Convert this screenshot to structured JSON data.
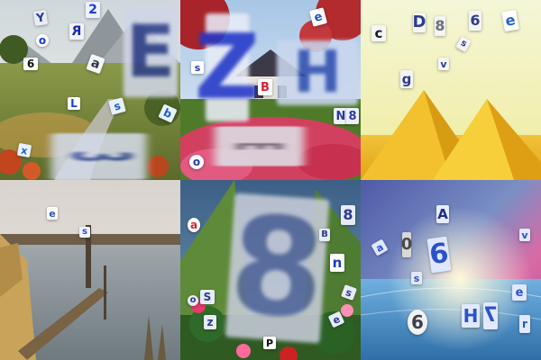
{
  "tiles": [
    {
      "theme": "mountain-valley",
      "glyphs": [
        {
          "char": "E",
          "color": "#2d3f8a",
          "bg": "#cfd6e6"
        },
        {
          "char": "3",
          "color": "#3a4f9c",
          "bg": "#d4dbe9"
        },
        {
          "char": "Y",
          "color": "#1f3b9b",
          "bg": "#e9edf5"
        },
        {
          "char": "2",
          "color": "#1d3ad8",
          "bg": "#eef2ff"
        },
        {
          "char": "R",
          "color": "#1b2ab0",
          "bg": "#f2f4fb"
        },
        {
          "char": "a",
          "color": "#2d2f4a",
          "bg": "#f5f5f5"
        },
        {
          "char": "6",
          "color": "#111111",
          "bg": "#ffffff"
        },
        {
          "char": "o",
          "color": "#1a3fd0",
          "bg": "#ffffff"
        },
        {
          "char": "L",
          "color": "#1a3fd0",
          "bg": "#ffffff"
        },
        {
          "char": "s",
          "color": "#1f5fbf",
          "bg": "#e8f1ff"
        },
        {
          "char": "b",
          "color": "#1f5fbf",
          "bg": "#e8f1ff"
        },
        {
          "char": "x",
          "color": "#1f5fbf",
          "bg": "#e8f1ff"
        }
      ]
    },
    {
      "theme": "cottage-garden",
      "glyphs": [
        {
          "char": "Z",
          "color": "#2438c8",
          "bg": "#e9ecf7"
        },
        {
          "char": "H",
          "color": "#2f4fb0",
          "bg": "#c9d6ee"
        },
        {
          "char": "E",
          "color": "#6f7381",
          "bg": "#dde0e6"
        },
        {
          "char": "B",
          "color": "#d8203a",
          "bg": "#ffffff"
        },
        {
          "char": "e",
          "color": "#244dc9",
          "bg": "#ffffff"
        },
        {
          "char": "N",
          "color": "#2a3aa6",
          "bg": "#eef1fb"
        },
        {
          "char": "8",
          "color": "#2a3aa6",
          "bg": "#eef1fb"
        },
        {
          "char": "o",
          "color": "#2a3aa6",
          "bg": "#ffffff"
        },
        {
          "char": "s",
          "color": "#2a3aa6",
          "bg": "#ffffff"
        }
      ]
    },
    {
      "theme": "desert-pyramids",
      "glyphs": [
        {
          "char": "c",
          "color": "#1a1a1a",
          "bg": "#f5f5f5"
        },
        {
          "char": "D",
          "color": "#2d3c8f",
          "bg": "#f4f4f4"
        },
        {
          "char": "8",
          "color": "#6b6f80",
          "bg": "#f4f4f4"
        },
        {
          "char": "6",
          "color": "#2d3c8f",
          "bg": "#f4f4f4"
        },
        {
          "char": "e",
          "color": "#2a63d4",
          "bg": "#ffffff"
        },
        {
          "char": "g",
          "color": "#2d3c8f",
          "bg": "#f4f4f4"
        },
        {
          "char": "v",
          "color": "#2d3c8f",
          "bg": "#f4f4f4"
        },
        {
          "char": "s",
          "color": "#2d3c8f",
          "bg": "#f4f4f4"
        }
      ]
    },
    {
      "theme": "lake-dock",
      "glyphs": [
        {
          "char": "e",
          "color": "#2a52c8",
          "bg": "#ffffff"
        },
        {
          "char": "s",
          "color": "#2a52c8",
          "bg": "#f0f3ff"
        }
      ]
    },
    {
      "theme": "jungle-flowers",
      "glyphs": [
        {
          "char": "8",
          "color": "#5a6c9e",
          "bg": "#c7ccd9"
        },
        {
          "char": "8",
          "color": "#2b3a8c",
          "bg": "#e7ebf5"
        },
        {
          "char": "n",
          "color": "#1f3cb8",
          "bg": "#ffffff"
        },
        {
          "char": "a",
          "color": "#d8203a",
          "bg": "#ffffff"
        },
        {
          "char": "S",
          "color": "#2b3a8c",
          "bg": "#e7ebf5"
        },
        {
          "char": "z",
          "color": "#2b3a8c",
          "bg": "#e7ebf5"
        },
        {
          "char": "o",
          "color": "#2b3a8c",
          "bg": "#e7ebf5"
        },
        {
          "char": "s",
          "color": "#2b3a8c",
          "bg": "#e7ebf5"
        },
        {
          "char": "e",
          "color": "#2b3a8c",
          "bg": "#e7ebf5"
        },
        {
          "char": "P",
          "color": "#111111",
          "bg": "#ffffff"
        },
        {
          "char": "B",
          "color": "#2b3a8c",
          "bg": "#e7ebf5"
        }
      ]
    },
    {
      "theme": "ocean-sunrise",
      "glyphs": [
        {
          "char": "A",
          "color": "#1b2f86",
          "bg": "#e6ecff"
        },
        {
          "char": "6",
          "color": "#2a52c8",
          "bg": "#dfe7ff"
        },
        {
          "char": "0",
          "color": "#4a4a4a",
          "bg": "#d9d9d9"
        },
        {
          "char": "H",
          "color": "#2a52c8",
          "bg": "#e2e9ff"
        },
        {
          "char": "7",
          "color": "#2a52c8",
          "bg": "#e2e9ff"
        },
        {
          "char": "e",
          "color": "#2a52c8",
          "bg": "#e2e9ff"
        },
        {
          "char": "6",
          "color": "#3c3f50",
          "bg": "#f2f2f2"
        },
        {
          "char": "a",
          "color": "#2a52c8",
          "bg": "#e2e9ff"
        },
        {
          "char": "s",
          "color": "#2a52c8",
          "bg": "#e2e9ff"
        },
        {
          "char": "v",
          "color": "#2a52c8",
          "bg": "#e2e9ff"
        },
        {
          "char": "r",
          "color": "#2a52c8",
          "bg": "#e2e9ff"
        }
      ]
    }
  ]
}
